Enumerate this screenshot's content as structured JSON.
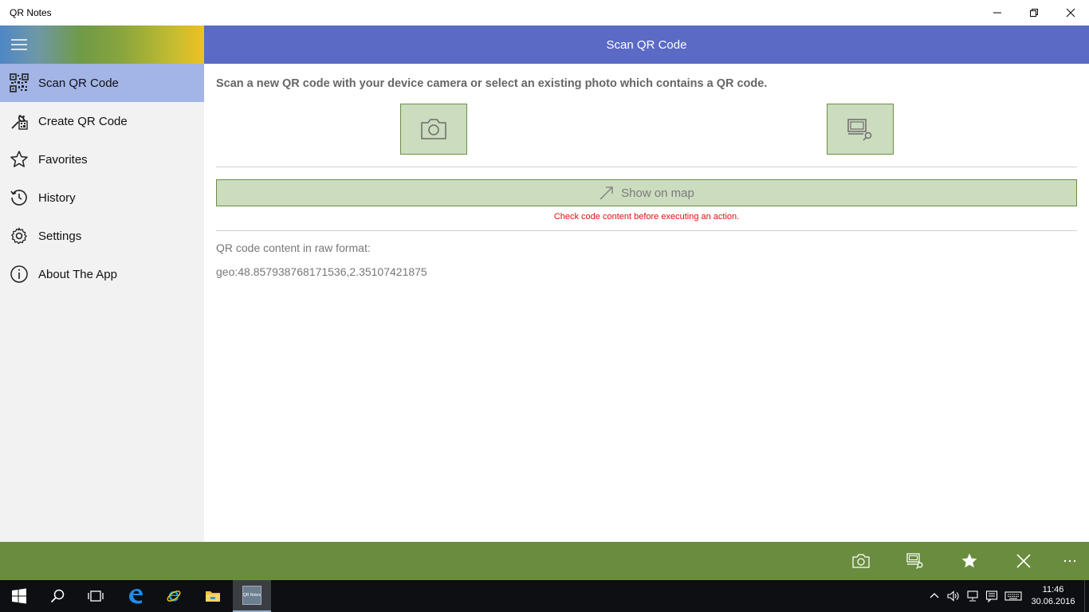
{
  "window": {
    "title": "QR Notes"
  },
  "header": {
    "title": "Scan QR Code"
  },
  "sidebar": {
    "items": [
      {
        "label": "Scan QR Code",
        "icon": "qr-code-icon",
        "active": true
      },
      {
        "label": "Create QR Code",
        "icon": "wrench-qr-icon",
        "active": false
      },
      {
        "label": "Favorites",
        "icon": "star-outline-icon",
        "active": false
      },
      {
        "label": "History",
        "icon": "history-icon",
        "active": false
      },
      {
        "label": "Settings",
        "icon": "gear-icon",
        "active": false
      },
      {
        "label": "About The App",
        "icon": "info-icon",
        "active": false
      }
    ]
  },
  "main": {
    "instructions": "Scan a new QR code with your device camera or select an existing photo which contains a QR code.",
    "map_button_label": "Show on map",
    "warning": "Check code content before executing an action.",
    "raw_label": "QR code content in raw format:",
    "raw_value": "geo:48.857938768171536,2.35107421875"
  },
  "taskbar": {
    "time": "11:46",
    "date": "30.06.2016",
    "app_thumb_text": "QR Notes"
  },
  "colors": {
    "header": "#5b6ac4",
    "active_nav": "#a3b4e6",
    "button_fill": "#ccdcbf",
    "appbar": "#6a8c3f",
    "warning": "#e01010"
  }
}
